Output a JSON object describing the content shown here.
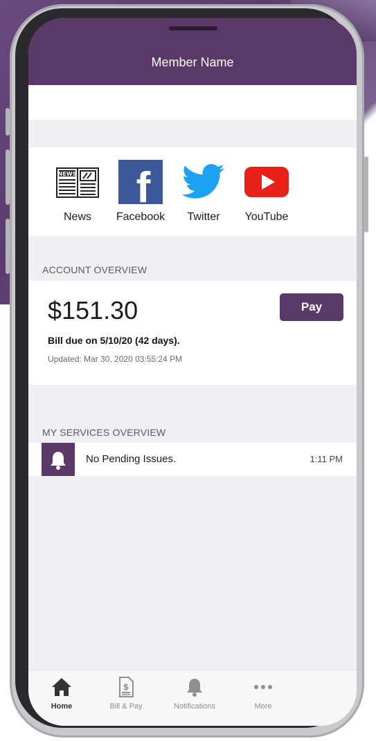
{
  "header": {
    "title": "Member Name"
  },
  "social": [
    {
      "label": "News",
      "icon": "news-icon"
    },
    {
      "label": "Facebook",
      "icon": "facebook-icon",
      "glyph": "f"
    },
    {
      "label": "Twitter",
      "icon": "twitter-icon"
    },
    {
      "label": "YouTube",
      "icon": "youtube-icon"
    }
  ],
  "account": {
    "section_title": "ACCOUNT OVERVIEW",
    "amount": "$151.30",
    "pay_label": "Pay",
    "bill_due": "Bill due on 5/10/20 (42 days).",
    "updated": "Updated: Mar 30, 2020 03:55:24 PM"
  },
  "services": {
    "section_title": "MY SERVICES OVERVIEW",
    "items": [
      {
        "text": "No Pending Issues.",
        "time": "1:11 PM",
        "icon": "bell-icon"
      }
    ]
  },
  "tabbar": {
    "items": [
      {
        "label": "Home",
        "icon": "home-icon",
        "active": true
      },
      {
        "label": "Bill & Pay",
        "icon": "bill-icon",
        "active": false
      },
      {
        "label": "Notifications",
        "icon": "bell-icon",
        "active": false
      },
      {
        "label": "More",
        "icon": "more-icon",
        "active": false
      }
    ]
  },
  "colors": {
    "brand": "#5a3868",
    "facebook": "#3b5998",
    "twitter": "#1da1f2",
    "youtube": "#e62117",
    "background": "#efeff4"
  }
}
